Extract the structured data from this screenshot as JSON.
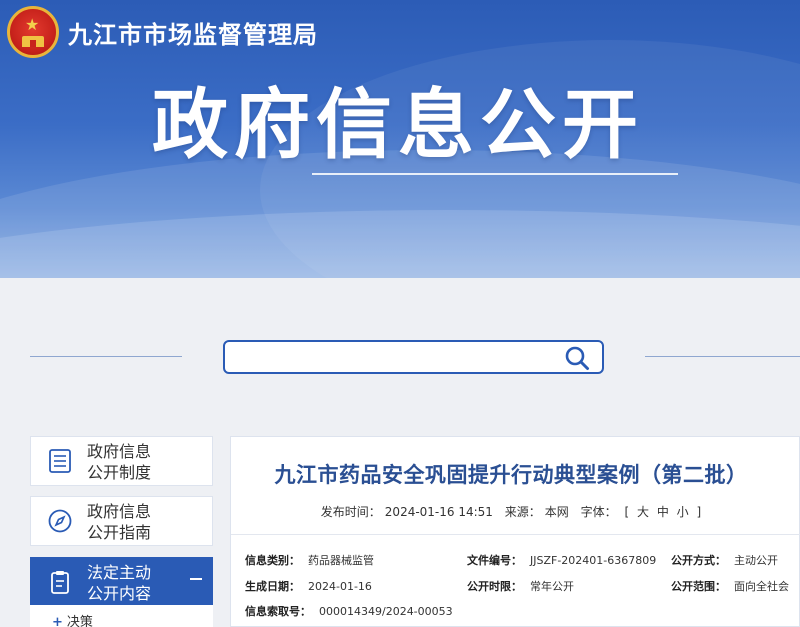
{
  "header": {
    "org_name": "九江市市场监督管理局",
    "banner_title": "政府信息公开"
  },
  "search": {
    "placeholder": "",
    "value": ""
  },
  "sidebar": {
    "items": [
      {
        "label": "政府信息\n公开制度",
        "icon": "document-list-icon"
      },
      {
        "label": "政府信息\n公开指南",
        "icon": "compass-icon"
      },
      {
        "label": "法定主动\n公开内容",
        "icon": "clipboard-icon",
        "active": true
      }
    ],
    "sub_items": [
      {
        "label": "决策"
      }
    ]
  },
  "article": {
    "title": "九江市药品安全巩固提升行动典型案例（第二批）",
    "publish_label": "发布时间：",
    "publish_time": "2024-01-16 14:51",
    "source_label": "来源：",
    "source": "本网",
    "font_label": "字体：",
    "font_open": "[",
    "font_large": "大",
    "font_medium": "中",
    "font_small": "小",
    "font_close": "]",
    "info": {
      "category_label": "信息类别：",
      "category": "药品器械监管",
      "doc_no_label": "文件编号：",
      "doc_no": "JJSZF-202401-6367809",
      "method_label": "公开方式：",
      "method": "主动公开",
      "date_label": "生成日期：",
      "date": "2024-01-16",
      "period_label": "公开时限：",
      "period": "常年公开",
      "scope_label": "公开范围：",
      "scope": "面向全社会",
      "index_label": "信息索取号：",
      "index": "000014349/2024-00053"
    }
  },
  "colors": {
    "primary": "#2a5bb5",
    "title": "#2a4f93",
    "banner_top": "#2c5cb6"
  }
}
